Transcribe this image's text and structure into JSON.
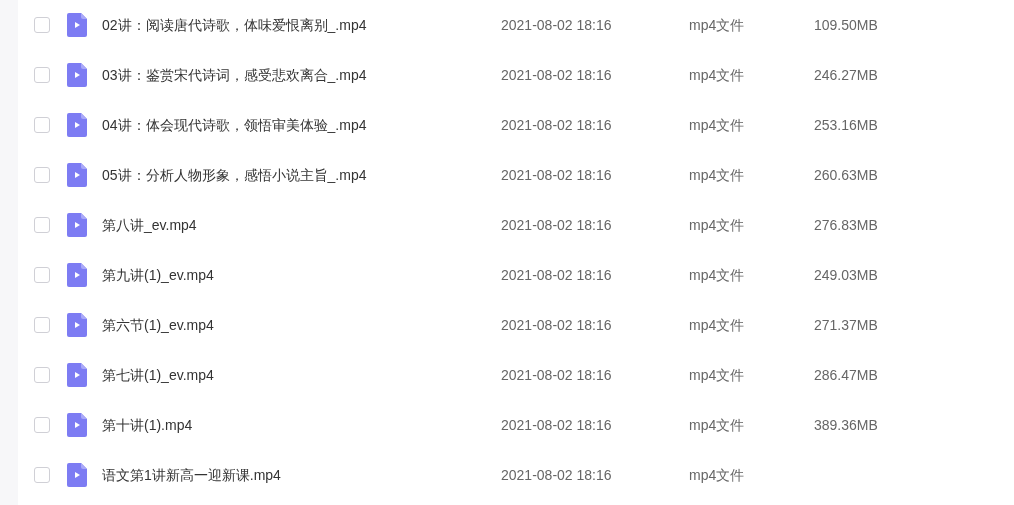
{
  "files": [
    {
      "checked": false,
      "name": "02讲：阅读唐代诗歌，体味爱恨离别_.mp4",
      "date": "2021-08-02 18:16",
      "type": "mp4文件",
      "size": "109.50MB"
    },
    {
      "checked": false,
      "name": "03讲：鉴赏宋代诗词，感受悲欢离合_.mp4",
      "date": "2021-08-02 18:16",
      "type": "mp4文件",
      "size": "246.27MB"
    },
    {
      "checked": false,
      "name": "04讲：体会现代诗歌，领悟审美体验_.mp4",
      "date": "2021-08-02 18:16",
      "type": "mp4文件",
      "size": "253.16MB"
    },
    {
      "checked": false,
      "name": "05讲：分析人物形象，感悟小说主旨_.mp4",
      "date": "2021-08-02 18:16",
      "type": "mp4文件",
      "size": "260.63MB"
    },
    {
      "checked": false,
      "name": "第八讲_ev.mp4",
      "date": "2021-08-02 18:16",
      "type": "mp4文件",
      "size": "276.83MB"
    },
    {
      "checked": false,
      "name": "第九讲(1)_ev.mp4",
      "date": "2021-08-02 18:16",
      "type": "mp4文件",
      "size": "249.03MB"
    },
    {
      "checked": false,
      "name": "第六节(1)_ev.mp4",
      "date": "2021-08-02 18:16",
      "type": "mp4文件",
      "size": "271.37MB"
    },
    {
      "checked": false,
      "name": "第七讲(1)_ev.mp4",
      "date": "2021-08-02 18:16",
      "type": "mp4文件",
      "size": "286.47MB"
    },
    {
      "checked": false,
      "name": "第十讲(1).mp4",
      "date": "2021-08-02 18:16",
      "type": "mp4文件",
      "size": "389.36MB"
    },
    {
      "checked": false,
      "name": "语文第1讲新高一迎新课.mp4",
      "date": "2021-08-02 18:16",
      "type": "mp4文件"
    }
  ]
}
